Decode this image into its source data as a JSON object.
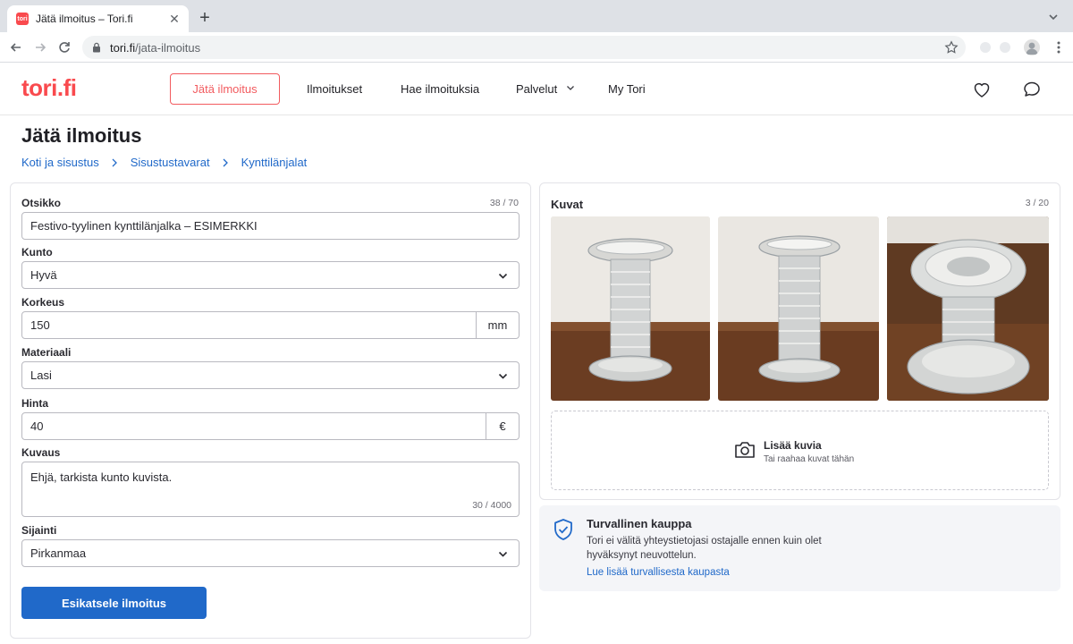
{
  "browser": {
    "tab_title": "Jätä ilmoitus – Tori.fi",
    "favicon_text": "tori",
    "url_host": "tori.fi",
    "url_path": "/jata-ilmoitus"
  },
  "header": {
    "logo": "tori.fi",
    "cta_label": "Jätä ilmoitus",
    "nav": [
      "Ilmoitukset",
      "Hae ilmoituksia",
      "Palvelut",
      "My Tori"
    ],
    "brand_color": "#f94a4e",
    "link_color": "#2069c9"
  },
  "page": {
    "title": "Jätä ilmoitus",
    "breadcrumb": [
      "Koti ja sisustus",
      "Sisustustavarat",
      "Kynttilänjalat"
    ]
  },
  "form": {
    "title_label": "Otsikko",
    "title_value": "Festivo-tyylinen kynttilänjalka – ESIMERKKI",
    "title_counter": "38 / 70",
    "condition_label": "Kunto",
    "condition_value": "Hyvä",
    "height_label": "Korkeus",
    "height_value": "150",
    "height_unit": "mm",
    "material_label": "Materiaali",
    "material_value": "Lasi",
    "price_label": "Hinta",
    "price_value": "40",
    "price_unit": "€",
    "description_label": "Kuvaus",
    "description_value": "Ehjä, tarkista kunto kuvista.",
    "description_counter": "30 / 4000",
    "location_label": "Sijainti",
    "location_value": "Pirkanmaa",
    "submit_label": "Esikatsele ilmoitus"
  },
  "images": {
    "title": "Kuvat",
    "counter": "3 / 20",
    "add_title": "Lisää kuvia",
    "add_subtitle": "Tai raahaa kuvat tähän"
  },
  "safety": {
    "title": "Turvallinen kauppa",
    "text": "Tori ei välitä yhteystietojasi ostajalle ennen kuin olet hyväksynyt neuvottelun.",
    "link": "Lue lisää turvallisesta kaupasta"
  }
}
